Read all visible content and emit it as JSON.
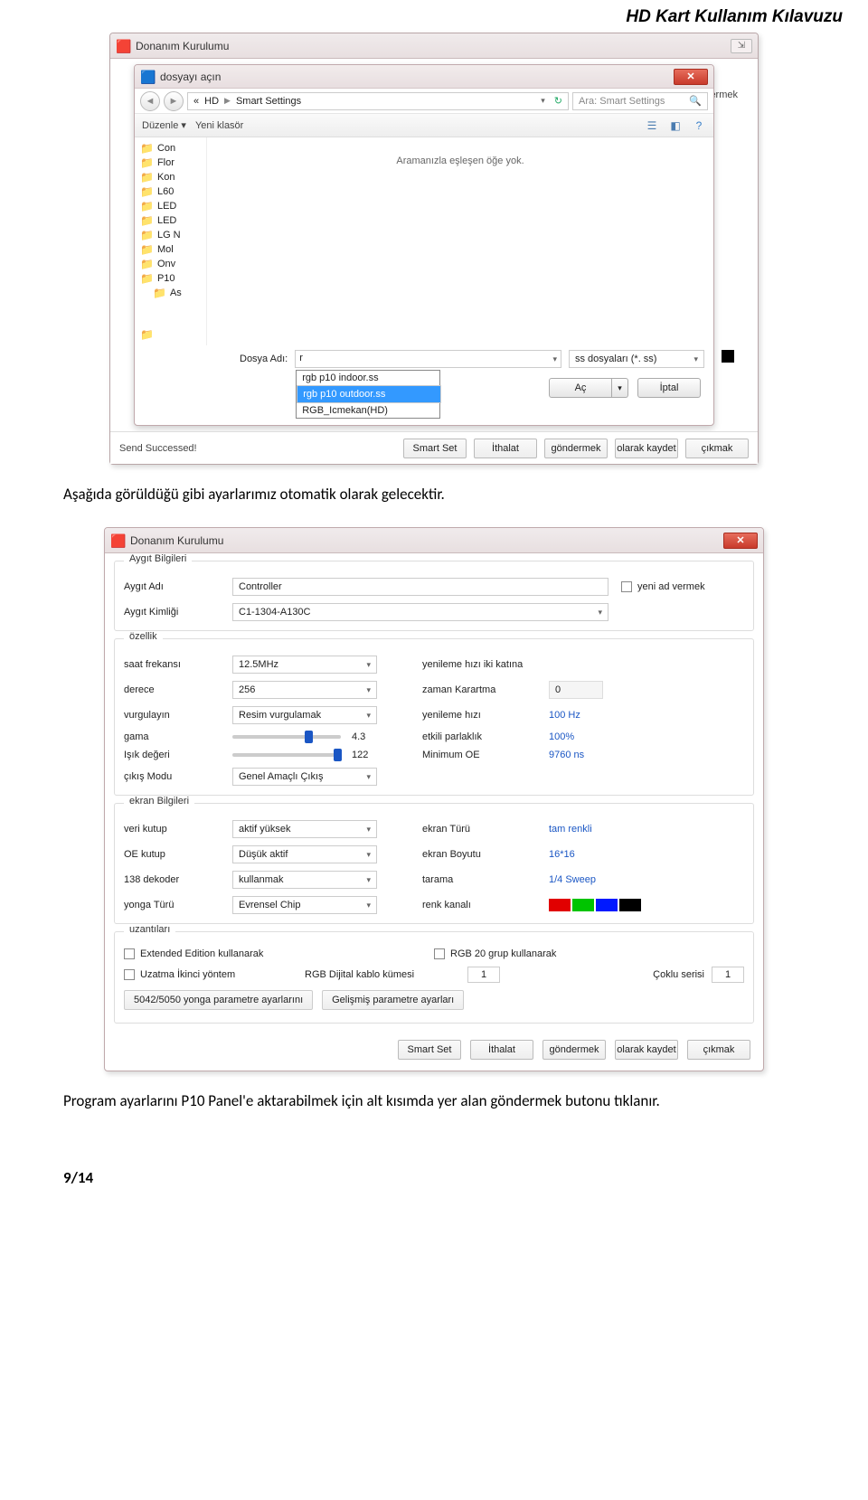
{
  "page_header": "HD Kart Kullanım Kılavuzu",
  "page_number": "9/14",
  "body_text_1": "Aşağıda görüldüğü gibi ayarlarımız otomatik olarak gelecektir.",
  "body_text_2": "Program ayarlarını P10 Panel'e aktarabilmek için alt kısımda yer alan göndermek butonu tıklanır.",
  "shot1": {
    "outer_title": "Donanım Kurulumu",
    "inner_title": "dosyayı açın",
    "breadcrumb_prefix": "«",
    "breadcrumb_1": "HD",
    "breadcrumb_2": "Smart Settings",
    "search_placeholder": "Ara: Smart Settings",
    "tree": [
      "Con",
      "Flor",
      "Kon",
      "L60",
      "LED",
      "LED",
      "LG N",
      "Mol",
      "Onv",
      "P10",
      "As"
    ],
    "toolbar_left": "Düzenle  ▾",
    "toolbar_new": "Yeni klasör",
    "empty_msg": "Aramanızla eşleşen öğe yok.",
    "file_label": "Dosya Adı:",
    "file_value": "r",
    "suggest": [
      "rgb p10 indoor.ss",
      "rgb p10 outdoor.ss",
      "RGB_Icmekan(HD)"
    ],
    "filter_text": "ss dosyaları (*. ss)",
    "btn_open": "Aç",
    "btn_cancel": "İptal",
    "peek_text": "ermek",
    "status": "Send Successed!",
    "bottom_btn_1": "Smart Set",
    "bottom_btn_2": "İthalat",
    "bottom_btn_3": "göndermek",
    "bottom_btn_4": "olarak kaydet",
    "bottom_btn_5": "çıkmak"
  },
  "shot2": {
    "title": "Donanım Kurulumu",
    "group_device": "Aygıt Bilgileri",
    "label_device_name": "Aygıt Adı",
    "val_device_name": "Controller",
    "cb_rename": "yeni ad vermek",
    "label_device_id": "Aygıt Kimliği",
    "val_device_id": "C1-1304-A130C",
    "group_prop": "özellik",
    "r_freq_l": "saat frekansı",
    "r_freq_v": "12.5MHz",
    "r_freq_rl": "yenileme hızı iki katına",
    "r_freq_rv": "",
    "r_deg_l": "derece",
    "r_deg_v": "256",
    "r_deg_rl": "zaman Karartma",
    "r_deg_rv": "0",
    "r_emph_l": "vurgulayın",
    "r_emph_v": "Resim vurgulamak",
    "r_emph_rl": "yenileme hızı",
    "r_emph_rv": "100 Hz",
    "r_gam_l": "gama",
    "r_gam_v": "4.3",
    "r_gam_rl": "etkili parlaklık",
    "r_gam_rv": "100%",
    "r_light_l": "Işık değeri",
    "r_light_v": "122",
    "r_light_rl": "Minimum OE",
    "r_light_rv": "9760 ns",
    "r_out_l": "çıkış Modu",
    "r_out_v": "Genel Amaçlı Çıkış",
    "group_screen": "ekran Bilgileri",
    "r_vp_l": "veri kutup",
    "r_vp_v": "aktif yüksek",
    "r_vp_rl": "ekran Türü",
    "r_vp_rv": "tam renkli",
    "r_oe_l": "OE kutup",
    "r_oe_v": "Düşük aktif",
    "r_oe_rl": "ekran Boyutu",
    "r_oe_rv": "16*16",
    "r_dec_l": "138 dekoder",
    "r_dec_v": "kullanmak",
    "r_dec_rl": "tarama",
    "r_dec_rv": "1/4 Sweep",
    "r_chip_l": "yonga Türü",
    "r_chip_v": "Evrensel Chip",
    "r_chip_rl": "renk kanalı",
    "swatches": [
      "#e10000",
      "#00c400",
      "#0019ff",
      "#000000"
    ],
    "group_ext": "uzantıları",
    "cb_ext_edition": "Extended Edition kullanarak",
    "cb_rgb20": "RGB 20 grup kullanarak",
    "cb_ext_second": "Uzatma İkinci yöntem",
    "lbl_rgb_cluster": "RGB Dijital kablo kümesi",
    "val_cluster": "1",
    "lbl_multi": "Çoklu serisi",
    "val_multi": "1",
    "btn_5042": "5042/5050 yonga parametre ayarlarını",
    "btn_adv": "Gelişmiş parametre ayarları",
    "btn_smart": "Smart Set",
    "btn_import": "İthalat",
    "btn_send": "göndermek",
    "btn_save": "olarak kaydet",
    "btn_exit": "çıkmak"
  }
}
